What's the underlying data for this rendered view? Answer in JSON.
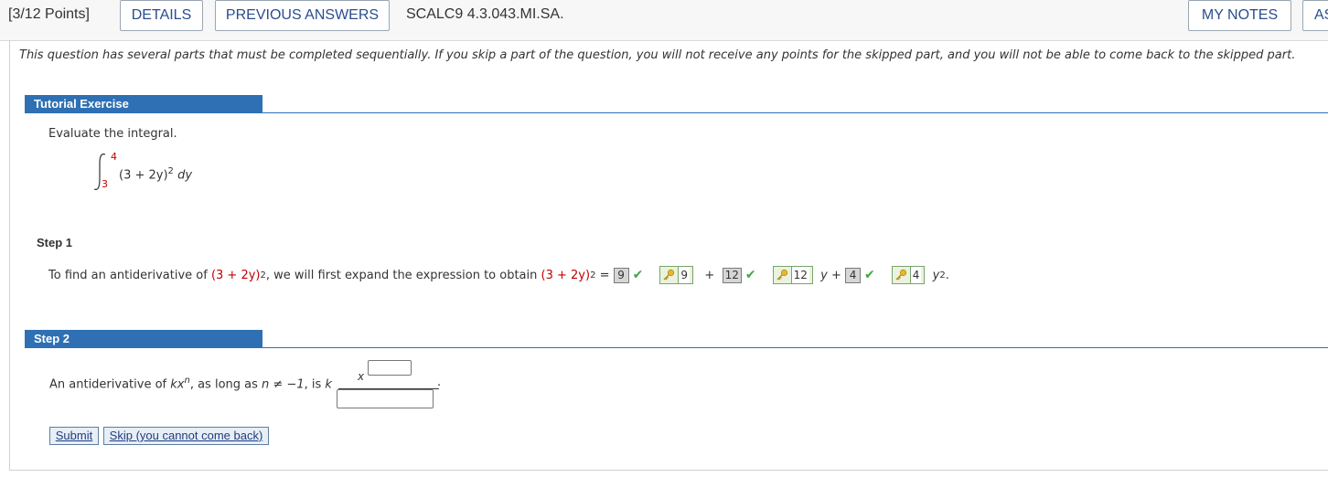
{
  "header": {
    "points": "[3/12 Points]",
    "details_label": "DETAILS",
    "previous_answers_label": "PREVIOUS ANSWERS",
    "problem_code": "SCALC9 4.3.043.MI.SA.",
    "my_notes_label": "MY NOTES",
    "ask_label": "AS"
  },
  "notice": "This question has several parts that must be completed sequentially. If you skip a part of the question, you will not receive any points for the skipped part, and you will not be able to come back to the skipped part.",
  "tutorial": {
    "title": "Tutorial Exercise",
    "prompt": "Evaluate the integral.",
    "integral": {
      "upper": "4",
      "lower": "3",
      "integrand": "(3 + 2y)",
      "exponent": "2",
      "differential": "dy"
    }
  },
  "step1": {
    "label": "Step 1",
    "text_before": "To find an antiderivative of",
    "expr": "(3 + 2y)",
    "expr_exp": "2",
    "text_middle": ", we will first expand the expression to obtain",
    "equals": "=",
    "answers": [
      "9",
      "12",
      "4"
    ],
    "key_values": [
      "9",
      "12",
      "4"
    ],
    "plus": "+",
    "y_var": "y",
    "y2": "y",
    "y2_exp": "2",
    "period": "."
  },
  "step2": {
    "label": "Step 2",
    "text_before": "An antiderivative of",
    "kx": "kx",
    "kx_exp": "n",
    "text_middle": ", as long as",
    "condition": "n ≠ −1",
    "text_after": ", is",
    "k": "k",
    "x": "x",
    "period": "."
  },
  "buttons": {
    "submit": "Submit",
    "skip": "Skip (you cannot come back)"
  },
  "colors": {
    "section_blue": "#2e70b3",
    "check_green": "#3fa843",
    "limit_red": "#c00000"
  }
}
